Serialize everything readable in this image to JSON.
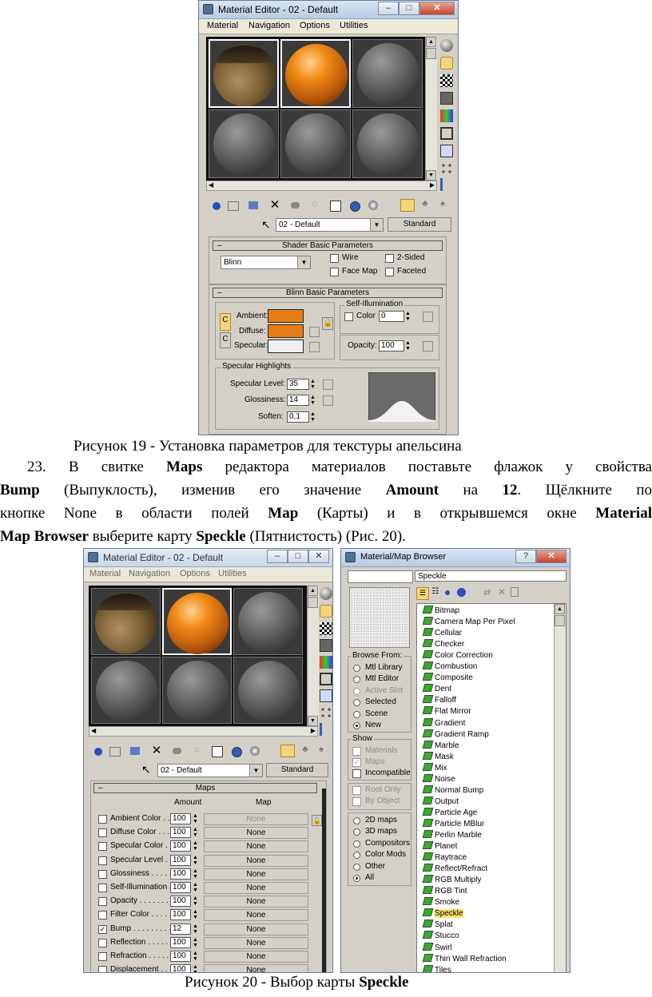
{
  "fig19": {
    "title": "Material Editor - 02 - Default",
    "menu": [
      "Material",
      "Navigation",
      "Options",
      "Utilities"
    ],
    "material_name": "02 - Default",
    "material_type": "Standard",
    "shader_rollout": "Shader Basic Parameters",
    "shader_type": "Blinn",
    "opt_wire": "Wire",
    "opt_2sided": "2-Sided",
    "opt_facemap": "Face Map",
    "opt_faceted": "Faceted",
    "blinn_rollout": "Blinn Basic Parameters",
    "self_illum": "Self-Illumination",
    "color_label": "Color",
    "color_value": "0",
    "ambient": "Ambient:",
    "diffuse": "Diffuse:",
    "specular": "Specular:",
    "opacity_label": "Opacity:",
    "opacity_value": "100",
    "spec_group": "Specular Highlights",
    "spec_level_label": "Specular Level:",
    "spec_level": "35",
    "gloss_label": "Glossiness:",
    "gloss": "14",
    "soften_label": "Soften:",
    "soften": "0,1",
    "c_btn": "C",
    "colors": {
      "ambient": "#e67e17",
      "diffuse": "#e67e17",
      "specular": "#f0f0f0"
    }
  },
  "caption19": "Рисунок 19 - Установка параметров для текстуры апельсина",
  "para": {
    "l1_a": "23. В свитке ",
    "l1_b": "Maps",
    "l1_c": " редактора материалов поставьте флажок у свойства",
    "l2_a": "Bump",
    "l2_b": " (Выпуклость), изменив его значение ",
    "l2_c": "Amount",
    "l2_d": " на ",
    "l2_e": "12",
    "l2_f": ". Щёлкните по",
    "l3_a": "кнопке None в области полей ",
    "l3_b": "Map",
    "l3_c": " (Карты) и в открывшемся окне ",
    "l3_d": "Material",
    "l4_a": "Map Browser",
    "l4_b": " выберите карту ",
    "l4_c": "Speckle",
    "l4_d": " (Пятнистость) (Рис. 20)."
  },
  "fig20": {
    "title": "Material Editor - 02 - Default",
    "menu": [
      "Material",
      "Navigation",
      "Options",
      "Utilities"
    ],
    "material_name": "02 - Default",
    "material_type": "Standard",
    "maps_rollout": "Maps",
    "col_amount": "Amount",
    "col_map": "Map",
    "rows": [
      {
        "label": "Ambient Color . . .",
        "amount": "100",
        "map": "None",
        "checked": false
      },
      {
        "label": "Diffuse Color . . . .",
        "amount": "100",
        "map": "None",
        "checked": false
      },
      {
        "label": "Specular Color . .",
        "amount": "100",
        "map": "None",
        "checked": false
      },
      {
        "label": "Specular Level . .",
        "amount": "100",
        "map": "None",
        "checked": false
      },
      {
        "label": "Glossiness . . . . .",
        "amount": "100",
        "map": "None",
        "checked": false
      },
      {
        "label": "Self-Illumination .",
        "amount": "100",
        "map": "None",
        "checked": false
      },
      {
        "label": "Opacity . . . . . . . .",
        "amount": "100",
        "map": "None",
        "checked": false
      },
      {
        "label": "Filter Color . . . . .",
        "amount": "100",
        "map": "None",
        "checked": false
      },
      {
        "label": "Bump . . . . . . . . .",
        "amount": "12",
        "map": "None",
        "checked": true
      },
      {
        "label": "Reflection . . . . .",
        "amount": "100",
        "map": "None",
        "checked": false
      },
      {
        "label": "Refraction . . . . .",
        "amount": "100",
        "map": "None",
        "checked": false
      },
      {
        "label": "Displacement . .",
        "amount": "100",
        "map": "None",
        "checked": false
      }
    ],
    "browser_title": "Material/Map Browser",
    "browser_name": "Speckle",
    "browse_from": "Browse From:",
    "browse_options": [
      "Mtl Library",
      "Mtl Editor",
      "Active Slot",
      "Selected",
      "Scene",
      "New"
    ],
    "show": "Show",
    "show_options": [
      "Materials",
      "Maps",
      "Incompatible"
    ],
    "root_only": "Root Only",
    "by_object": "By Object",
    "type_options": [
      "2D maps",
      "3D maps",
      "Compositors",
      "Color Mods",
      "Other",
      "All"
    ],
    "map_list": [
      "Bitmap",
      "Camera Map Per Pixel",
      "Cellular",
      "Checker",
      "Color Correction",
      "Combustion",
      "Composite",
      "Dent",
      "Falloff",
      "Flat Mirror",
      "Gradient",
      "Gradient Ramp",
      "Marble",
      "Mask",
      "Mix",
      "Noise",
      "Normal Bump",
      "Output",
      "Particle Age",
      "Particle MBlur",
      "Perlin Marble",
      "Planet",
      "Raytrace",
      "Reflect/Refract",
      "RGB Multiply",
      "RGB Tint",
      "Smoke",
      "Speckle",
      "Splat",
      "Stucco",
      "Swirl",
      "Thin Wall Refraction",
      "Tiles"
    ]
  },
  "caption20_a": "Рисунок 20 - Выбор карты ",
  "caption20_b": "Speckle"
}
